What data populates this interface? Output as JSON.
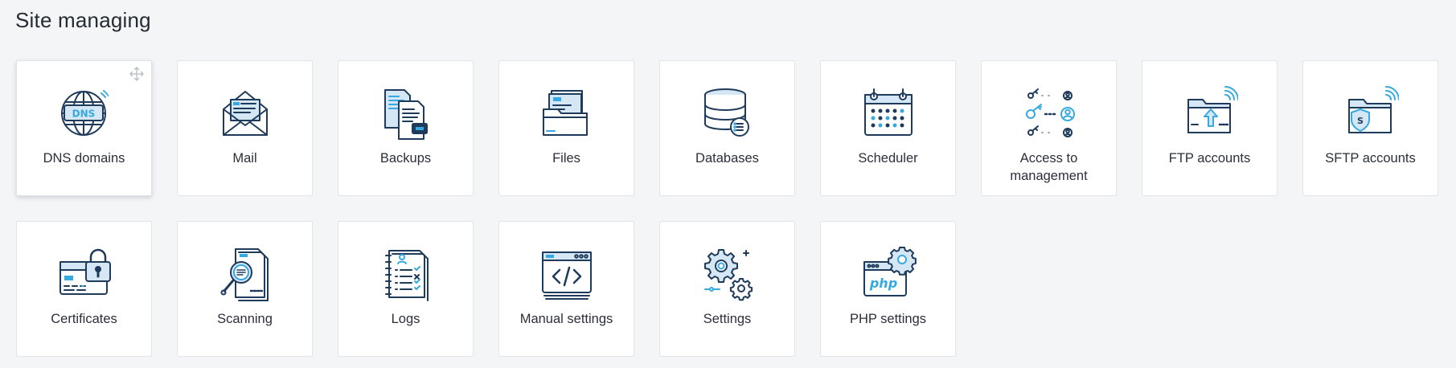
{
  "page": {
    "title": "Site managing"
  },
  "colors": {
    "accent": "#36a9e1",
    "dark": "#1f3b5c",
    "fill_light": "#d5e6f4"
  },
  "tiles": [
    {
      "label": "DNS domains",
      "icon": "dns-globe-icon"
    },
    {
      "label": "Mail",
      "icon": "mail-envelope-icon"
    },
    {
      "label": "Backups",
      "icon": "backups-documents-icon"
    },
    {
      "label": "Files",
      "icon": "files-folder-icon"
    },
    {
      "label": "Databases",
      "icon": "database-icon"
    },
    {
      "label": "Scheduler",
      "icon": "calendar-icon"
    },
    {
      "label": "Access to management",
      "icon": "access-keys-users-icon"
    },
    {
      "label": "FTP accounts",
      "icon": "ftp-folder-upload-icon"
    },
    {
      "label": "SFTP accounts",
      "icon": "sftp-folder-shield-icon"
    },
    {
      "label": "Certificates",
      "icon": "certificate-lock-icon"
    },
    {
      "label": "Scanning",
      "icon": "scanning-magnifier-icon"
    },
    {
      "label": "Logs",
      "icon": "logs-notebook-icon"
    },
    {
      "label": "Manual settings",
      "icon": "code-window-icon"
    },
    {
      "label": "Settings",
      "icon": "gears-icon"
    },
    {
      "label": "PHP settings",
      "icon": "php-window-gear-icon"
    }
  ],
  "icon_text": {
    "dns": "DNS",
    "php": "php",
    "sftp": "S"
  }
}
